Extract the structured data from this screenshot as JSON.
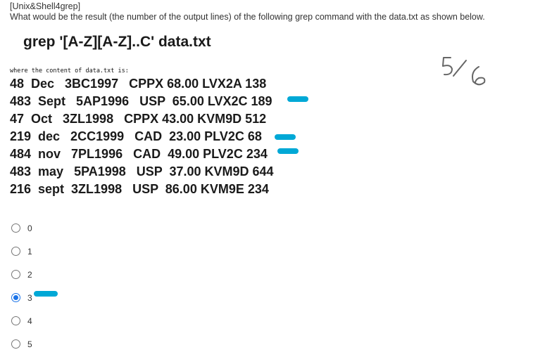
{
  "header": {
    "tag": "[Unix&Shell4grep]",
    "question": "What would be the result (the number of the output lines) of the following grep command with the data.txt as shown below."
  },
  "command": "grep '[A-Z][A-Z]..C' data.txt",
  "data_caption": "where the content of data.txt is:",
  "data_lines": [
    "48  Dec   3BC1997   CPPX 68.00 LVX2A 138",
    "483  Sept   5AP1996   USP  65.00 LVX2C 189",
    "47  Oct   3ZL1998   CPPX 43.00 KVM9D 512",
    "219  dec   2CC1999   CAD  23.00 PLV2C 68",
    "484  nov   7PL1996   CAD  49.00 PLV2C 234",
    "483  may   5PA1998   USP  37.00 KVM9D 644",
    "216  sept  3ZL1998   USP  86.00 KVM9E 234"
  ],
  "options": [
    {
      "label": "0",
      "selected": false
    },
    {
      "label": "1",
      "selected": false
    },
    {
      "label": "2",
      "selected": false
    },
    {
      "label": "3",
      "selected": true
    },
    {
      "label": "4",
      "selected": false
    },
    {
      "label": "5",
      "selected": false
    }
  ],
  "handwritten_note": "5/6",
  "colors": {
    "highlight": "#00a8d6",
    "radio_selected": "#1a73e8"
  }
}
